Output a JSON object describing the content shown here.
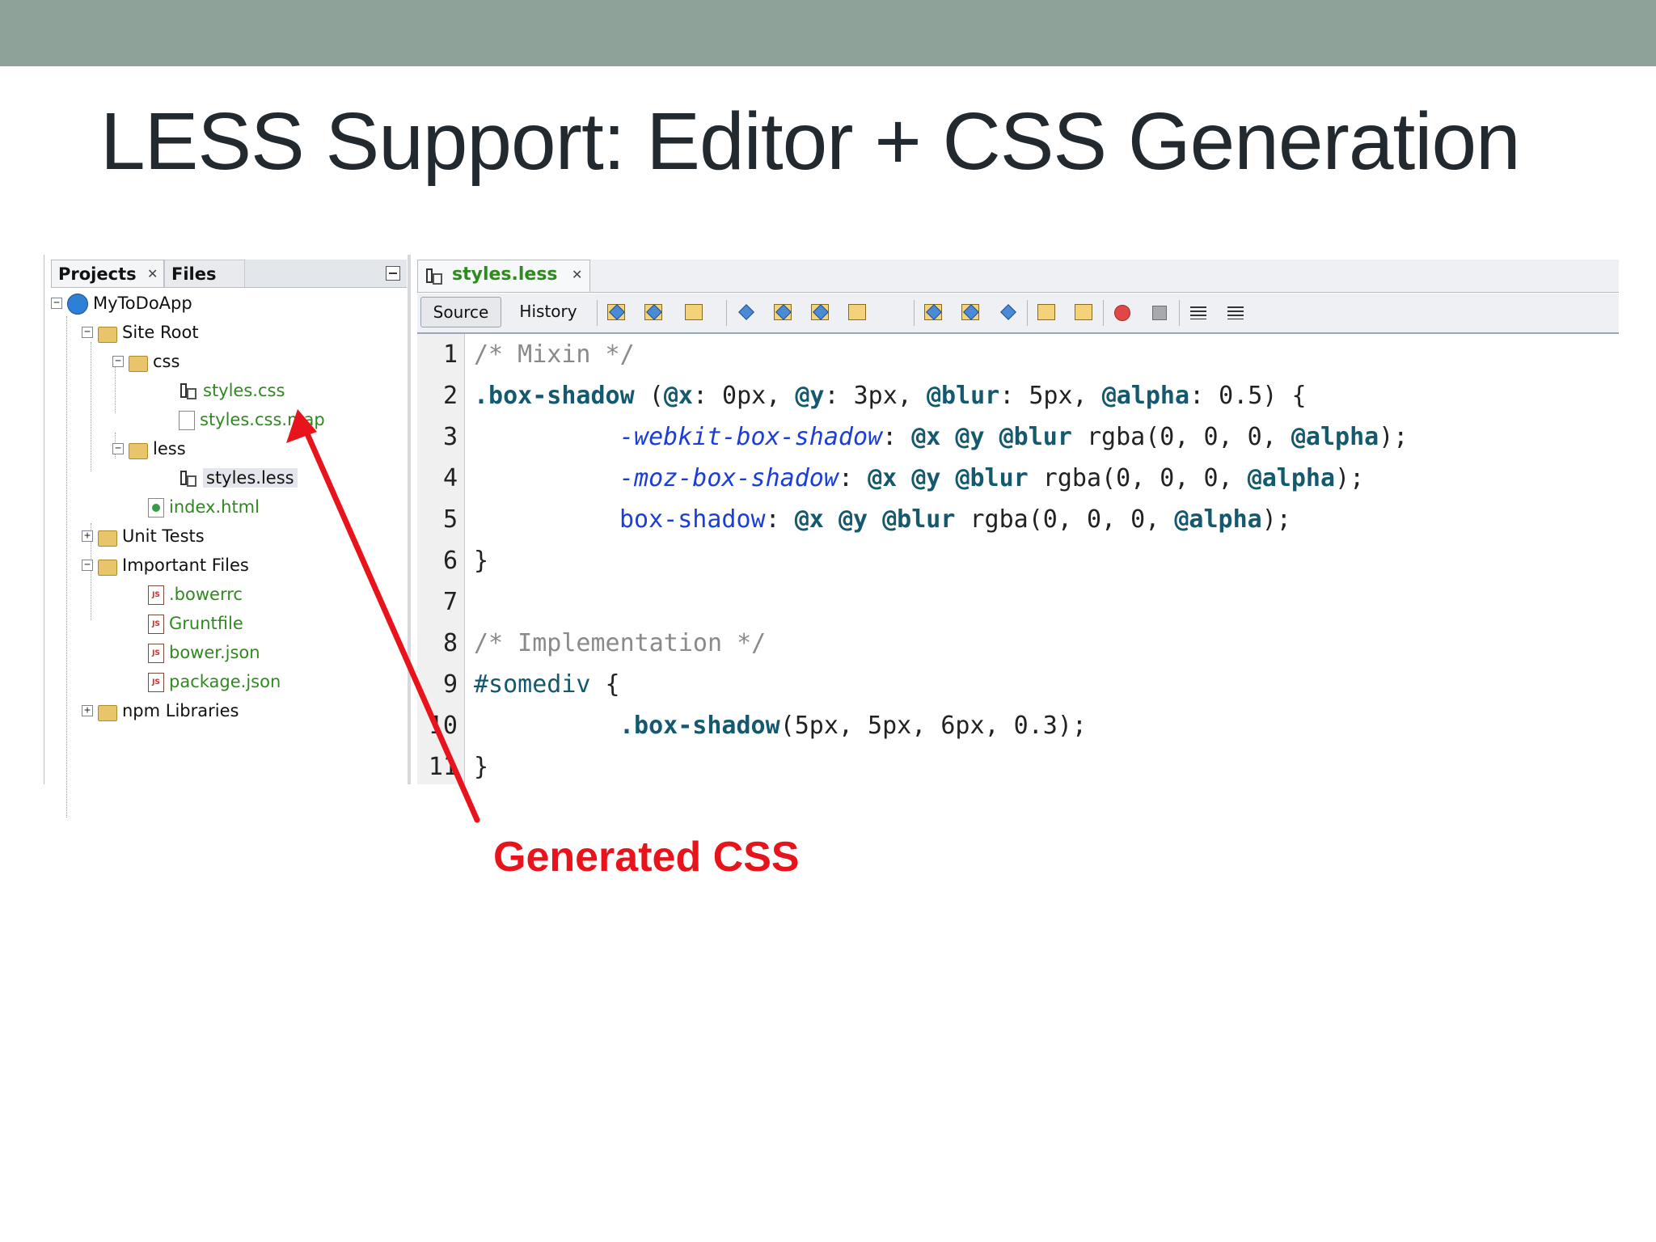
{
  "slide": {
    "title": "LESS Support: Editor + CSS Generation",
    "annotation": "Generated CSS",
    "accent_color": "#e8131b",
    "topbar_color": "#8fa29a"
  },
  "projects_panel": {
    "tabs": [
      {
        "label": "Projects"
      },
      {
        "label": "Files"
      }
    ],
    "tree": [
      {
        "label": "MyToDoApp",
        "icon": "project-globe-icon"
      },
      {
        "label": "Site Root",
        "icon": "folder-icon"
      },
      {
        "label": "css",
        "icon": "folder-icon"
      },
      {
        "label": "styles.css",
        "icon": "css-file-icon"
      },
      {
        "label": "styles.css.map",
        "icon": "file-icon"
      },
      {
        "label": "less",
        "icon": "folder-icon"
      },
      {
        "label": "styles.less",
        "icon": "less-file-icon"
      },
      {
        "label": "index.html",
        "icon": "html-file-icon"
      },
      {
        "label": "Unit Tests",
        "icon": "folder-icon"
      },
      {
        "label": "Important Files",
        "icon": "folder-icon"
      },
      {
        "label": ".bowerrc",
        "icon": "js-file-icon"
      },
      {
        "label": "Gruntfile",
        "icon": "js-file-icon"
      },
      {
        "label": "bower.json",
        "icon": "js-file-icon"
      },
      {
        "label": "package.json",
        "icon": "js-file-icon"
      },
      {
        "label": "npm Libraries",
        "icon": "library-icon"
      }
    ]
  },
  "editor": {
    "tab_label": "styles.less",
    "toolbar": {
      "source_label": "Source",
      "history_label": "History"
    },
    "line_numbers": [
      "1",
      "2",
      "3",
      "4",
      "5",
      "6",
      "7",
      "8",
      "9",
      "10",
      "11"
    ],
    "code": {
      "l1": "/* Mixin */",
      "l2_sel": ".box-shadow",
      "l2_a": " (",
      "l2_x": "@x",
      "l2_b": ": 0px, ",
      "l2_y": "@y",
      "l2_c": ": 3px, ",
      "l2_blur": "@blur",
      "l2_d": ": 5px, ",
      "l2_alpha": "@alpha",
      "l2_e": ": 0.5) {",
      "l3_prop": "-webkit-box-shadow",
      "l4_prop": "-moz-box-shadow",
      "l5_prop": "box-shadow",
      "colon": ": ",
      "v_x": "@x",
      "v_y": "@y",
      "v_blur": "@blur",
      "rgba_open": " rgba(0, 0, 0, ",
      "v_alpha": "@alpha",
      "rgba_close": ");",
      "l6": "}",
      "l8": "/* Implementation */",
      "l9_sel": "#somediv",
      "l9_b": " {",
      "l10_call": ".box-shadow",
      "l10_args": "(5px, 5px, 6px, 0.3);",
      "l11": "}"
    }
  }
}
